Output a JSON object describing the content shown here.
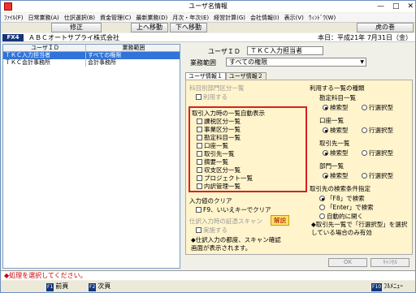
{
  "window": {
    "title": "ユーザ名情報"
  },
  "menu": [
    "ﾌｧｲﾙ(F)",
    "日常業務(A)",
    "仕訳選択(B)",
    "資金管理(C)",
    "最新業務(D)",
    "月次・年次(E)",
    "経営計算(G)",
    "会社情報(I)",
    "表示(V)",
    "ｳｨﾝﾄﾞｳ(W)"
  ],
  "toolbar": {
    "fix": "修正",
    "prev": "上へ移動",
    "next": "下へ移動",
    "tora": "虎の巻"
  },
  "company": {
    "code": "FX4",
    "name": "ＡＢＣオートサプライ株式会社",
    "date": "本日：平成21年 7月31日（金）"
  },
  "userlist": {
    "headers": [
      "ユーザＩＤ",
      "業務範囲"
    ],
    "rows": [
      [
        "ＴＫＣ入力担当者",
        "すべての権限"
      ],
      [
        "ＴＫＣ会計事務所",
        "会計事務所"
      ]
    ]
  },
  "form": {
    "user_id_label": "ユーザＩＤ",
    "user_id_value": "ＴＫＣ入力担当者",
    "scope_label": "業務範囲",
    "scope_value": "すべての権限"
  },
  "tabs": [
    "ユーザ情報１",
    "ユーザ情報２"
  ],
  "panel": {
    "kamoku_title": "科目別部門区分一覧",
    "kamoku_use": "利用する",
    "auto_title": "取引入力時の一覧自動表示",
    "auto_items": [
      "課税区分一覧",
      "事業区分一覧",
      "勘定科目一覧",
      "口座一覧",
      "取引先一覧",
      "摘要一覧",
      "収支区分一覧",
      "プロジェクト一覧",
      "内訳管理一覧"
    ],
    "clear_title": "入力値のクリア",
    "clear_item": "F9、いいえキーでクリア",
    "scan_title": "仕訳入力時の証憑スキャン",
    "scan_btn": "解説",
    "scan_item": "実施する",
    "note": "◆仕訳入力の都度、スキャン確認画面が表示されます。",
    "types_title": "利用する一覧の種類",
    "types": [
      {
        "name": "勘定科目一覧",
        "a": "検索型",
        "b": "行選択型"
      },
      {
        "name": "口座一覧",
        "a": "検索型",
        "b": "行選択型"
      },
      {
        "name": "取引先一覧",
        "a": "検索型",
        "b": "行選択型"
      },
      {
        "name": "部門一覧",
        "a": "検索型",
        "b": "行選択型"
      }
    ],
    "search_title": "取引先の検索条件指定",
    "search_opts": [
      "「F8」で検索",
      "「Enter」で検索",
      "自動的に開く"
    ],
    "search_note": "◆取引先一覧で「行選択型」を選択している場合のみ有効"
  },
  "buttons": {
    "ok": "OK",
    "cancel": "ｷｬﾝｾﾙ"
  },
  "status": "◆処理を選択してください。",
  "fkeys": {
    "f1": "前頁",
    "f2": "次頁",
    "f10": "ﾌﾙﾒﾆｭｰ",
    "f1_key": "F1",
    "f2_key": "F2",
    "f10_key": "F10"
  }
}
